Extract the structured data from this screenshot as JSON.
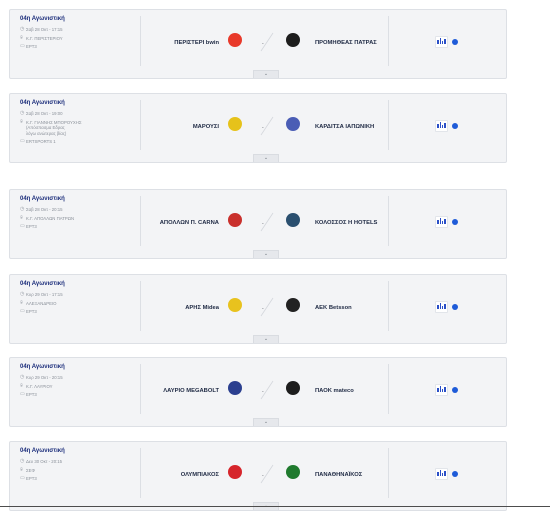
{
  "colors": {
    "accent": "#1e5bd8",
    "round_title": "#1a2c7a",
    "card_bg": "#f3f4f6"
  },
  "icons": {
    "date": "clock-icon",
    "venue": "location-pin-icon",
    "tv": "tv-icon",
    "stats": "bar-chart-icon",
    "expand": "chevron-down-icon"
  },
  "matches": [
    {
      "round": "04η Αγωνιστική",
      "datetime": "Σαβ 28 Οκτ - 17:15",
      "venue": "Κ.Γ. ΠΕΡΙΣΤΕΡΙΟΥ",
      "tv": "ΕΡΤ3",
      "home": "ΠΕΡΙΣΤΕΡΙ bwin",
      "away": "ΠΡΟΜΗΘΕΑΣ ΠΑΤΡΑΣ",
      "home_logo_color": "#e8392a",
      "away_logo_color": "#1d1d1d",
      "separator": "-"
    },
    {
      "round": "04η Αγωνιστική",
      "datetime": "Σαβ 28 Οκτ - 19:00",
      "venue": "Κ.Γ. ΓΙΑΝΝΗΣ ΜΠΟΡΟΥΧΗΣ\n(Απόσπασμα Εδρας\nλόγω ανώτερας βίας)",
      "tv": "ERTSPORTS 1",
      "home": "ΜΑΡΟΥΣΙ",
      "away": "ΚΑΡΔΙΤΣΑ ΙΑΠΩΝΙΚΗ",
      "home_logo_color": "#e6c21a",
      "away_logo_color": "#4a5db5",
      "separator": "-"
    },
    {
      "round": "04η Αγωνιστική",
      "datetime": "Σαβ 28 Οκτ - 20:15",
      "venue": "Κ.Γ. ΑΠΟΛΛΩΝ ΠΑΤΡΩΝ",
      "tv": "ΕΡΤ3",
      "home": "ΑΠΟΛΛΩΝ Π. CARNA",
      "away": "ΚΟΛΟΣΣΟΣ Η HOTELS",
      "home_logo_color": "#c9302c",
      "away_logo_color": "#2a4f6f",
      "separator": "-"
    },
    {
      "round": "04η Αγωνιστική",
      "datetime": "Κυρ 29 Οκτ - 17:15",
      "venue": "ΑΛΕΞΑΝΔΡΕΙΟ",
      "tv": "ΕΡΤ3",
      "home": "ΑΡΗΣ Midea",
      "away": "ΑΕΚ Betsson",
      "home_logo_color": "#e8c21e",
      "away_logo_color": "#222222",
      "separator": "-"
    },
    {
      "round": "04η Αγωνιστική",
      "datetime": "Κυρ 29 Οκτ - 20:15",
      "venue": "Κ.Γ. ΛΑΥΡΙΟΥ",
      "tv": "ΕΡΤ3",
      "home": "ΛΑΥΡΙΟ MEGABOLT",
      "away": "ΠΑΟΚ mateco",
      "home_logo_color": "#2b3f8f",
      "away_logo_color": "#1d1d1d",
      "separator": "-"
    },
    {
      "round": "04η Αγωνιστική",
      "datetime": "Δευ 30 Οκτ - 20:15",
      "venue": "ΣΕΦ",
      "tv": "ΕΡΤ3",
      "home": "ΟΛΥΜΠΙΑΚΟΣ",
      "away": "ΠΑΝΑΘΗΝΑΪΚΟΣ",
      "home_logo_color": "#d6252b",
      "away_logo_color": "#1f7a2e",
      "separator": "-"
    }
  ]
}
